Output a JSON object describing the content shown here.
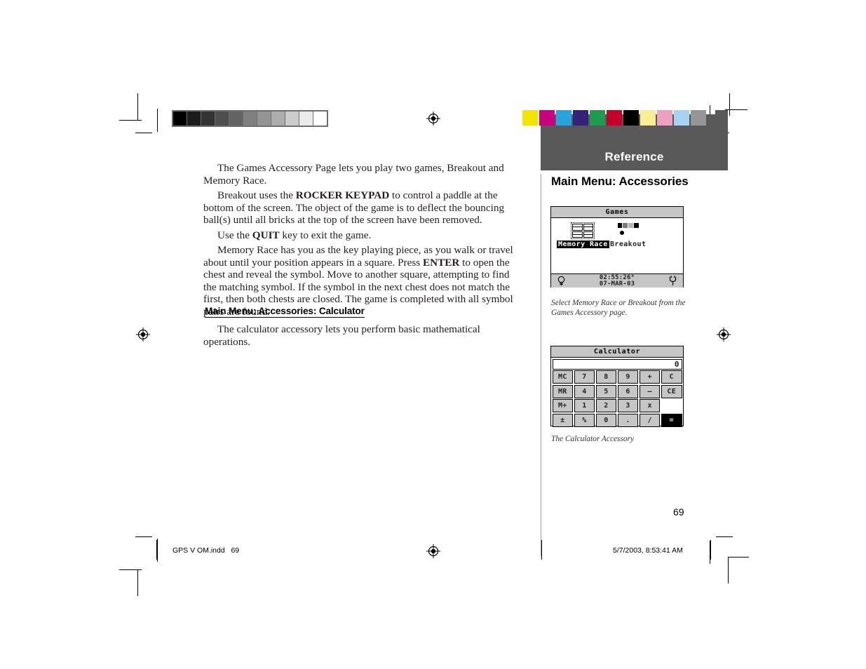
{
  "page": {
    "number": "69",
    "section_band": "Reference",
    "sidebar_title": "Main Menu: Accessories"
  },
  "body": {
    "paragraphs": [
      "The Games Accessory Page lets you play two games, Breakout and Memory Race.",
      "Breakout uses the ROCKER KEYPAD to control a paddle at the bottom of the screen. The object of the game is to deflect the bouncing ball(s) until all bricks at the top of the screen have been removed.",
      "Use the QUIT key to exit the game.",
      "Memory Race has you as the key playing piece, as you walk or travel about until your position appears in a square.  Press ENTER to open the chest and reveal the symbol.  Move to another square, attempting to find the matching symbol.  If the symbol in the next chest does not match the first, then both chests are closed.  The game is completed with all symbol pairs are found."
    ],
    "p1_text": "The Games Accessory Page lets you play two games, Breakout and Memory Race.",
    "p2_a": "Breakout uses the ",
    "p2_bold": "ROCKER KEYPAD",
    "p2_b": " to control a paddle at the bottom of the screen. The object of the game is to deflect the bouncing ball(s) until all bricks at the top of the screen have been removed.",
    "p3_a": "Use the ",
    "p3_bold": "QUIT",
    "p3_b": " key to exit the game.",
    "p4_a": "Memory Race has you as the key playing piece, as you walk or travel about until your position appears in a square.  Press ",
    "p4_bold": "ENTER",
    "p4_b": " to open the chest and reveal the symbol.  Move to another square, attempting to find the matching symbol.  If the symbol in the next chest does not match the first, then both chests are closed.  The game is completed with all symbol pairs are found.",
    "section_heading": "Main Menu: Accessories: Calculator",
    "calculator_paragraph": "The calculator accessory lets you perform basic mathematical operations."
  },
  "figures": {
    "games": {
      "title": "Games",
      "items": [
        {
          "label": "Memory Race",
          "selected": true,
          "icon": "memory-race-icon"
        },
        {
          "label": "Breakout",
          "selected": false,
          "icon": "breakout-icon"
        }
      ],
      "status": {
        "backlight_icon": "light-bulb-icon",
        "time": "02:55:26ʰ",
        "date": "07-MAR-03",
        "power_icon": "power-plug-icon"
      },
      "caption": "Select Memory Race or Breakout from the Games Accessory page."
    },
    "calculator": {
      "title": "Calculator",
      "display": "0",
      "keys": [
        "MC",
        "7",
        "8",
        "9",
        "+",
        "C",
        "MR",
        "4",
        "5",
        "6",
        "–",
        "CE",
        "M+",
        "1",
        "2",
        "3",
        "x",
        "",
        "±",
        "%",
        "0",
        ".",
        "/",
        "="
      ],
      "caption": "The Calculator Accessory"
    }
  },
  "print_marks": {
    "grayscale_bar": [
      "#000000",
      "#1c1c1c",
      "#333333",
      "#4f4f4f",
      "#636363",
      "#808080",
      "#949494",
      "#adadad",
      "#cccccc",
      "#ebebeb",
      "#ffffff"
    ],
    "color_bar": [
      "#f3e500",
      "#c9017e",
      "#29a3dc",
      "#33217a",
      "#1e9b4e",
      "#c4002a",
      "#000000",
      "#faee94",
      "#eda0bf",
      "#a7d3f2",
      "#969696"
    ],
    "registration_icon": "registration-target-icon"
  },
  "footer": {
    "left": "GPS V OM.indd   69",
    "right": "5/7/2003, 8:53:41 AM"
  }
}
